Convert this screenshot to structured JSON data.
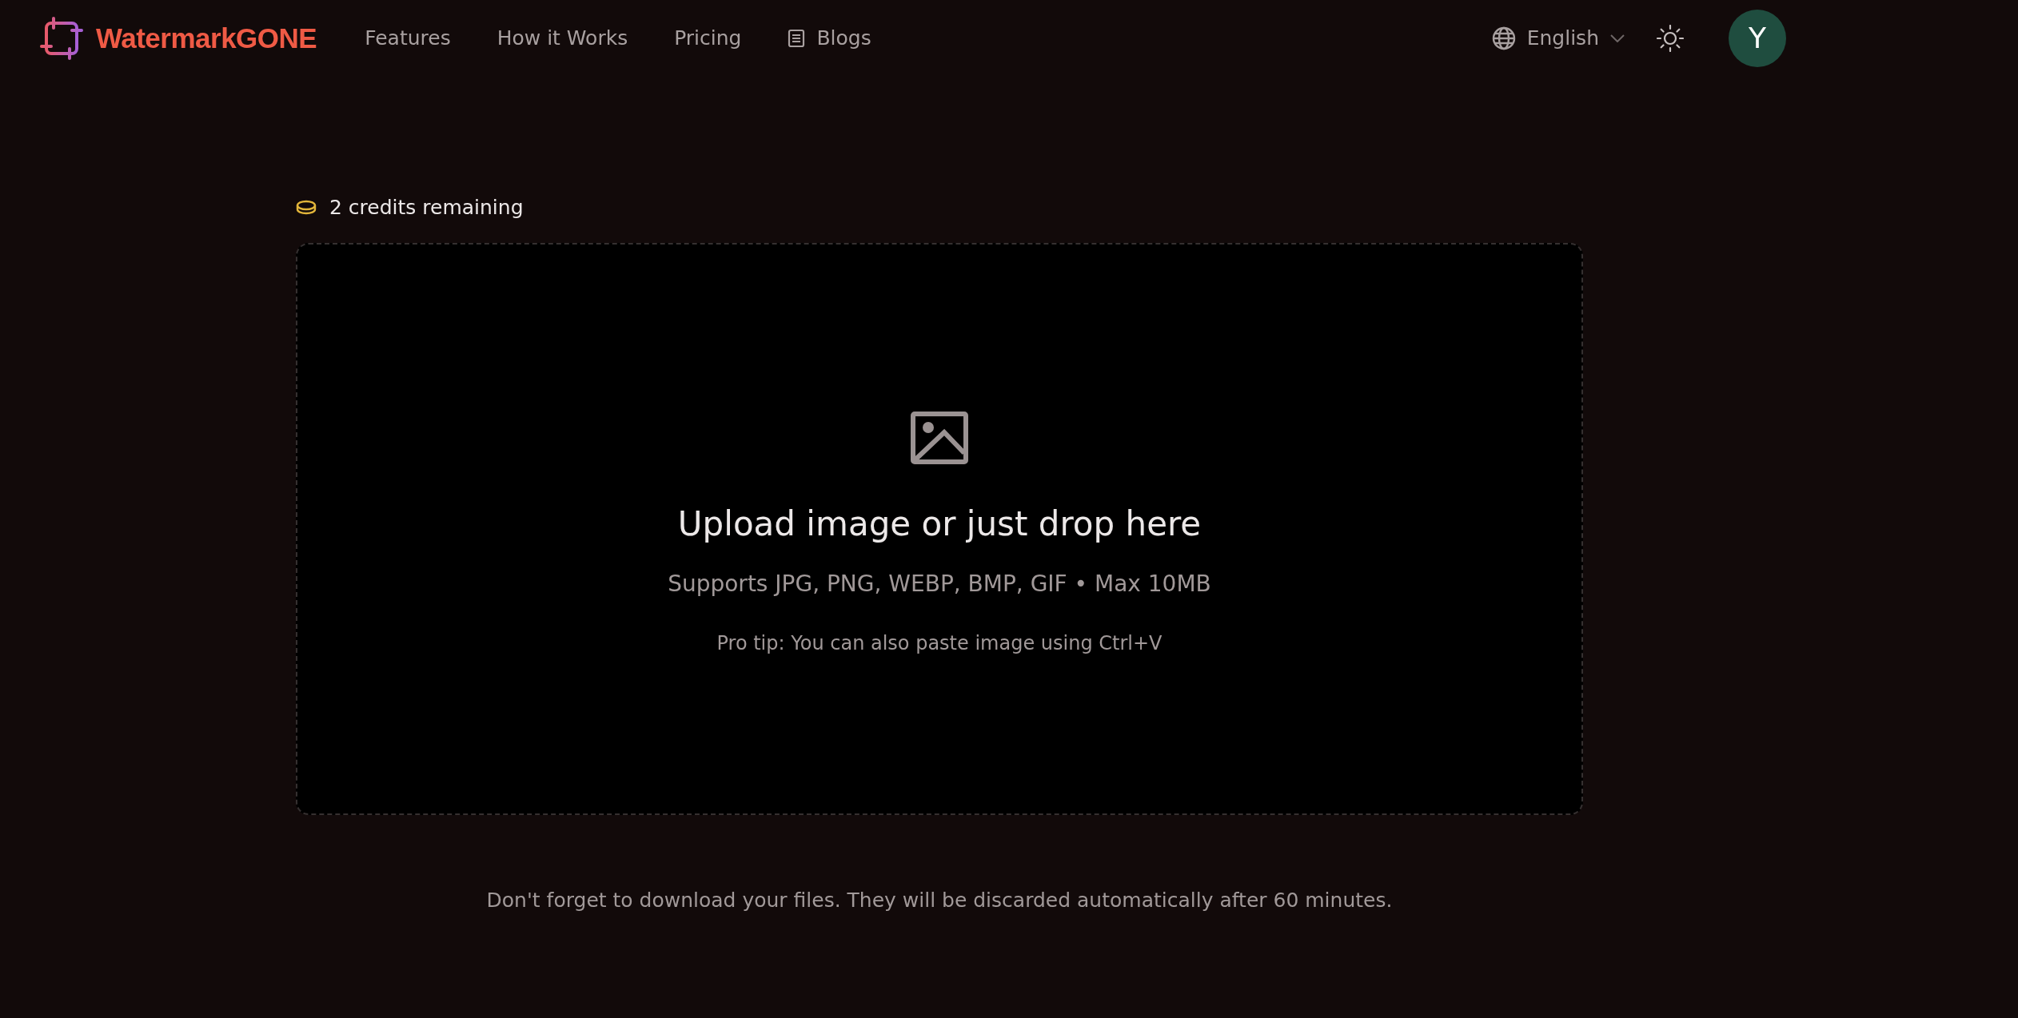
{
  "header": {
    "logo": "WatermarkGONE",
    "nav": [
      {
        "label": "Features",
        "kind": "link"
      },
      {
        "label": "How it Works",
        "kind": "link"
      },
      {
        "label": "Pricing",
        "kind": "link"
      },
      {
        "label": "Blogs",
        "kind": "blog"
      }
    ],
    "language": "English",
    "avatar": "Y"
  },
  "credits": "2 credits remaining",
  "dropzone": {
    "title": "Upload image or just drop here",
    "formats": "Supports JPG, PNG, WEBP, BMP, GIF • Max 10MB",
    "tip": "Pro tip: You can also paste image using Ctrl+V"
  },
  "notice": "Don't forget to download your files. They will be discarded automatically after 60 minutes."
}
